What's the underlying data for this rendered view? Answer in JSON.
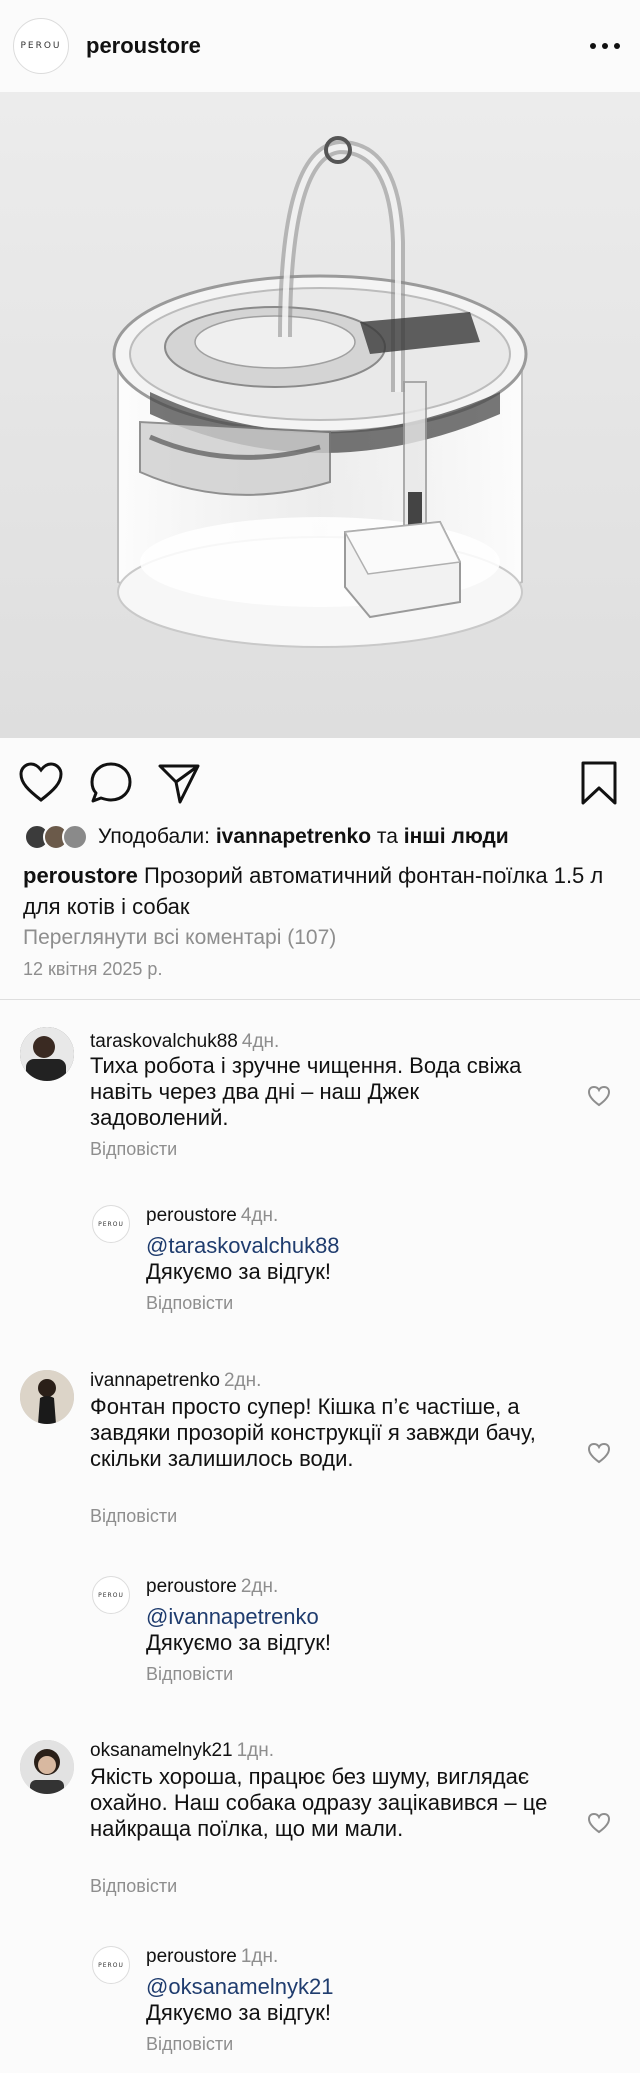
{
  "header": {
    "logo_text": "PEROU",
    "username": "peroustore"
  },
  "post": {
    "liked_prefix": "Уподобали:",
    "liked_user": "ivannapetrenko",
    "liked_and": "та",
    "liked_others": "інші люди",
    "caption_user": "peroustore",
    "caption_text": "Прозорий автоматичний фонтан-поїлка 1.5 л для котів і собак",
    "view_all": "Переглянути всі коментарі (107)",
    "date": "12 квітня 2025 р."
  },
  "icons": {
    "like": "heart-outline-icon",
    "comment": "comment-bubble-icon",
    "share": "paper-plane-icon",
    "save": "bookmark-icon",
    "more": "more-dots-icon"
  },
  "comments": [
    {
      "user": "taraskovalchuk88",
      "time": "4дн.",
      "text": "Тиха робота і зручне чищення. Вода свіжа навіть через два дні – наш Джек задоволений.",
      "reply_label": "Відповісти",
      "reply": {
        "user": "peroustore",
        "time": "4дн.",
        "mention": "@taraskovalchuk88",
        "text": "Дякуємо за відгук!",
        "reply_label": "Відповісти"
      }
    },
    {
      "user": "ivannapetrenko",
      "time": "2дн.",
      "text": "Фонтан просто супер! Кішка п’є частіше, а завдяки прозорій конструкції я завжди бачу, скільки залишилось води.",
      "reply_label": "Відповісти",
      "reply": {
        "user": "peroustore",
        "time": "2дн.",
        "mention": "@ivannapetrenko",
        "text": "Дякуємо за відгук!",
        "reply_label": "Відповісти"
      }
    },
    {
      "user": "oksanamelnyk21",
      "time": "1дн.",
      "text": "Якість хороша, працює без шуму, виглядає охайно. Наш собака одразу зацікавився – це найкраща поїлка, що ми мали.",
      "reply_label": "Відповісти",
      "reply": {
        "user": "peroustore",
        "time": "1дн.",
        "mention": "@oksanamelnyk21",
        "text": "Дякуємо за відгук!",
        "reply_label": "Відповісти"
      }
    }
  ]
}
